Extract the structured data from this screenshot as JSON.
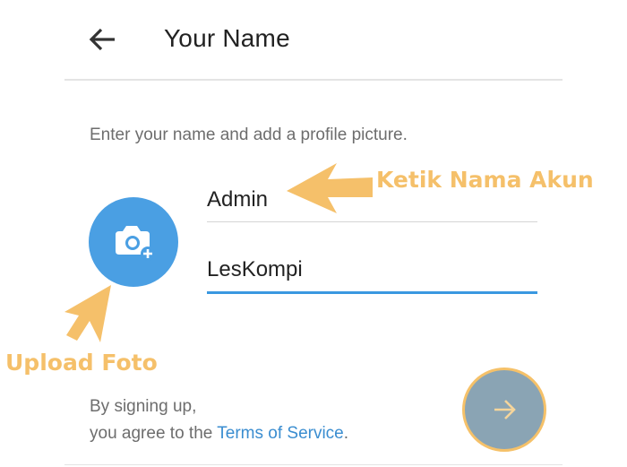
{
  "header": {
    "title": "Your Name",
    "back_icon": "arrow-left-icon"
  },
  "instruction": "Enter your name and add a profile picture.",
  "avatar": {
    "icon": "camera-add-icon",
    "color": "#4a9fe3"
  },
  "form": {
    "first_name": "Admin",
    "last_name": "LesKompi",
    "active_underline_color": "#3a98e0"
  },
  "footer": {
    "line1": "By signing up,",
    "line2_prefix": "you agree to the ",
    "terms_link": "Terms of Service",
    "line2_suffix": "."
  },
  "next_button": {
    "icon": "arrow-right-icon"
  },
  "annotations": {
    "name_hint": "Ketik Nama Akun",
    "upload_hint": "Upload Foto",
    "color": "#f5c06a"
  }
}
